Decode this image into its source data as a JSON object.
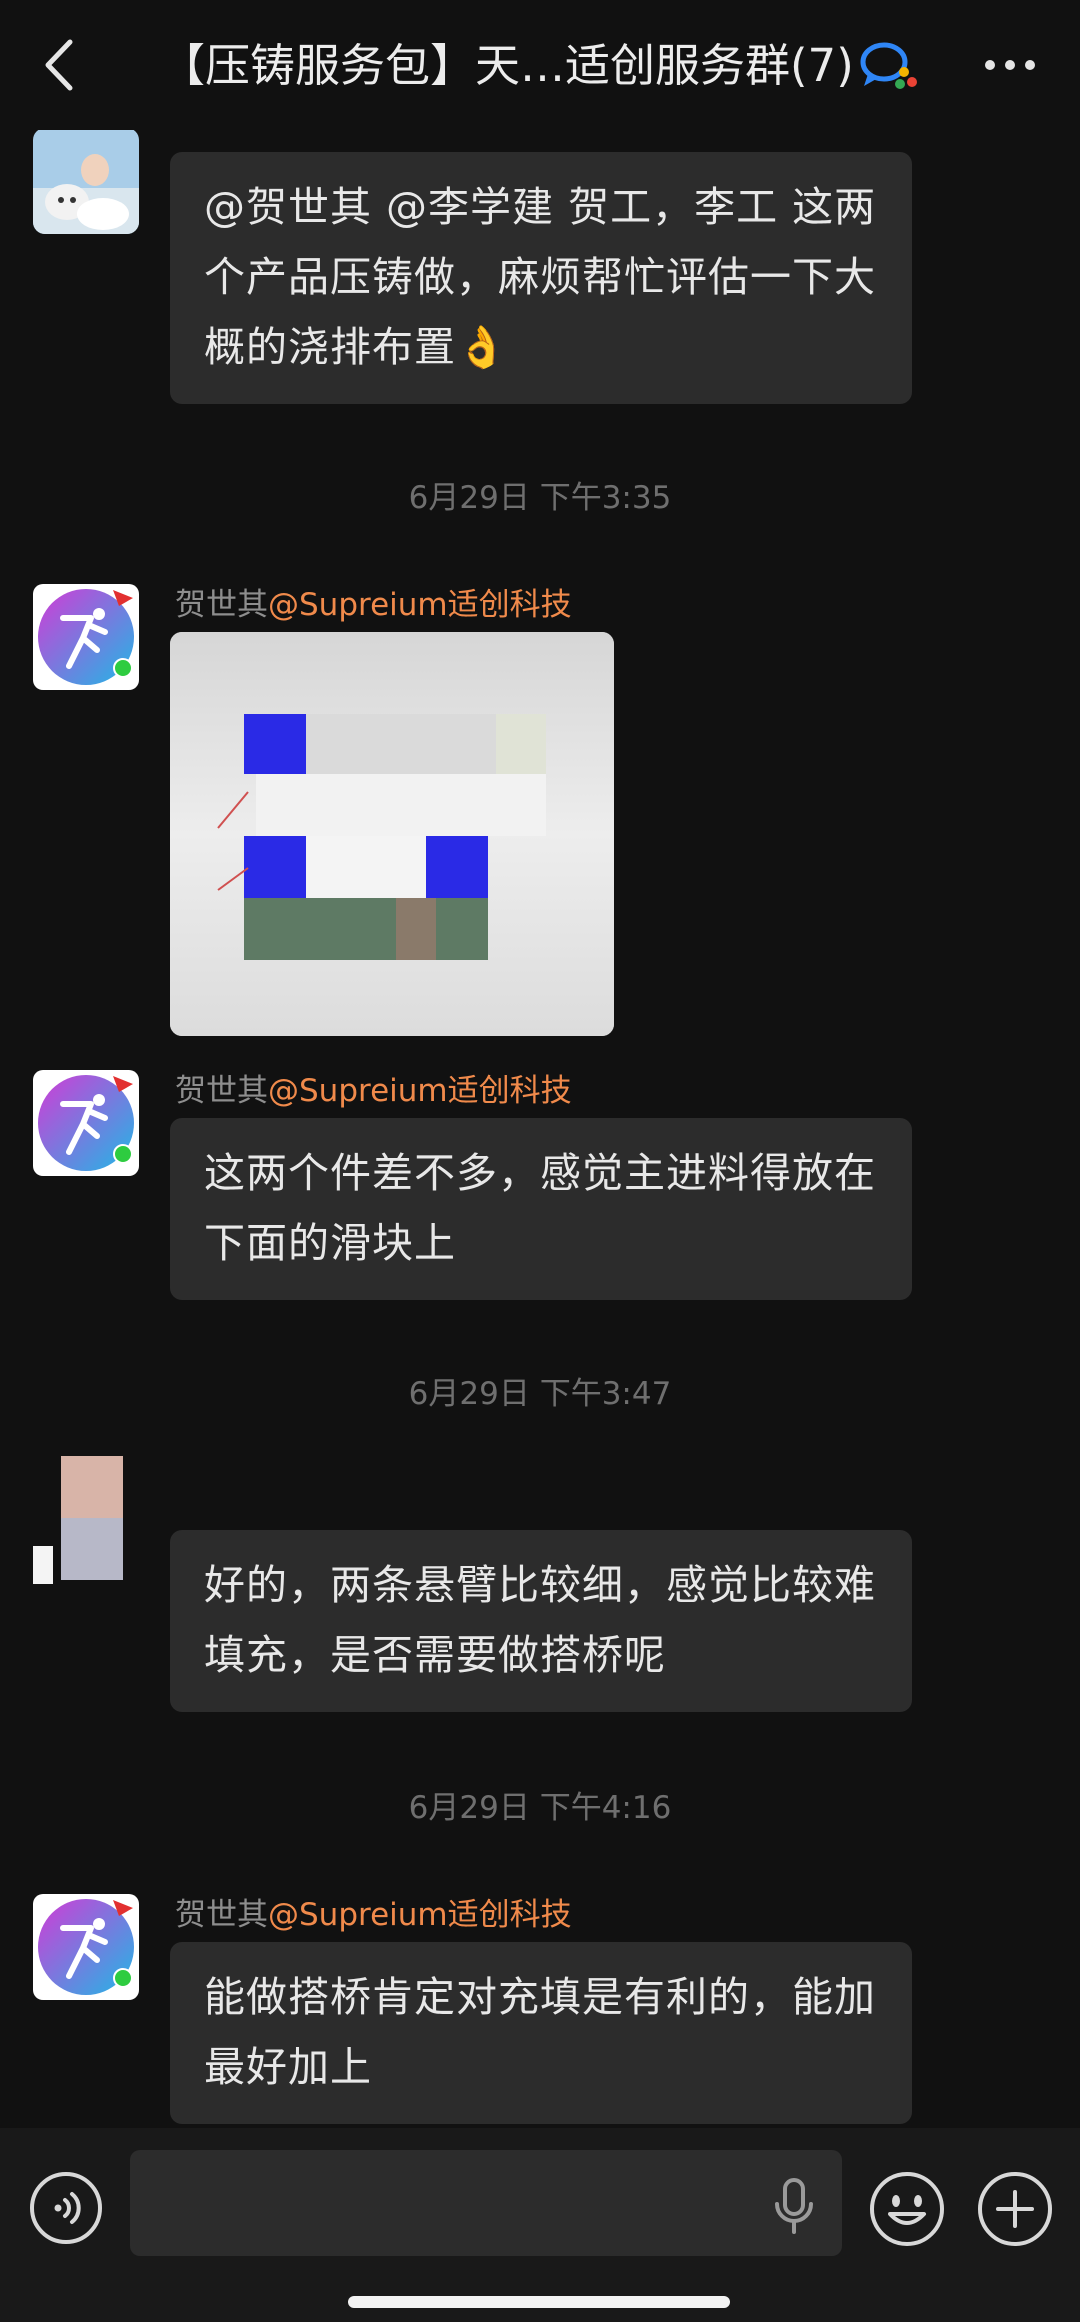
{
  "header": {
    "title": "【压铸服务包】天…适创服务群(7)",
    "back_icon": "chevron-left-icon",
    "chat_icon": "group-chat-icon",
    "more_icon": "more-horizontal-icon"
  },
  "messages": [
    {
      "sender_name": "",
      "bubble_text": "@贺世其 @李学建  贺工，李工 这两个产品压铸做，麻烦帮忙评估一下大概的浇排布置👌"
    },
    {
      "timestamp": "6月29日 下午3:35",
      "sender_name": "贺世其",
      "sender_org": "@Supreium适创科技",
      "type": "image"
    },
    {
      "sender_name": "贺世其",
      "sender_org": "@Supreium适创科技",
      "bubble_text": "这两个件差不多，感觉主进料得放在下面的滑块上"
    },
    {
      "timestamp": "6月29日 下午3:47",
      "sender_name": "",
      "bubble_text": "好的，两条悬臂比较细，感觉比较难填充，是否需要做搭桥呢"
    },
    {
      "timestamp": "6月29日 下午4:16",
      "sender_name": "贺世其",
      "sender_org": "@Supreium适创科技",
      "bubble_text": "能做搭桥肯定对充填是有利的，能加最好加上"
    }
  ],
  "input_bar": {
    "placeholder": "",
    "voice_icon": "voice-mode-icon",
    "mic_icon": "microphone-icon",
    "emoji_icon": "emoji-icon",
    "plus_icon": "plus-circle-icon"
  },
  "colors": {
    "background": "#111111",
    "bubble": "#2c2c2c",
    "org_accent": "#f08a4b",
    "timestamp": "#6f6f6f"
  }
}
